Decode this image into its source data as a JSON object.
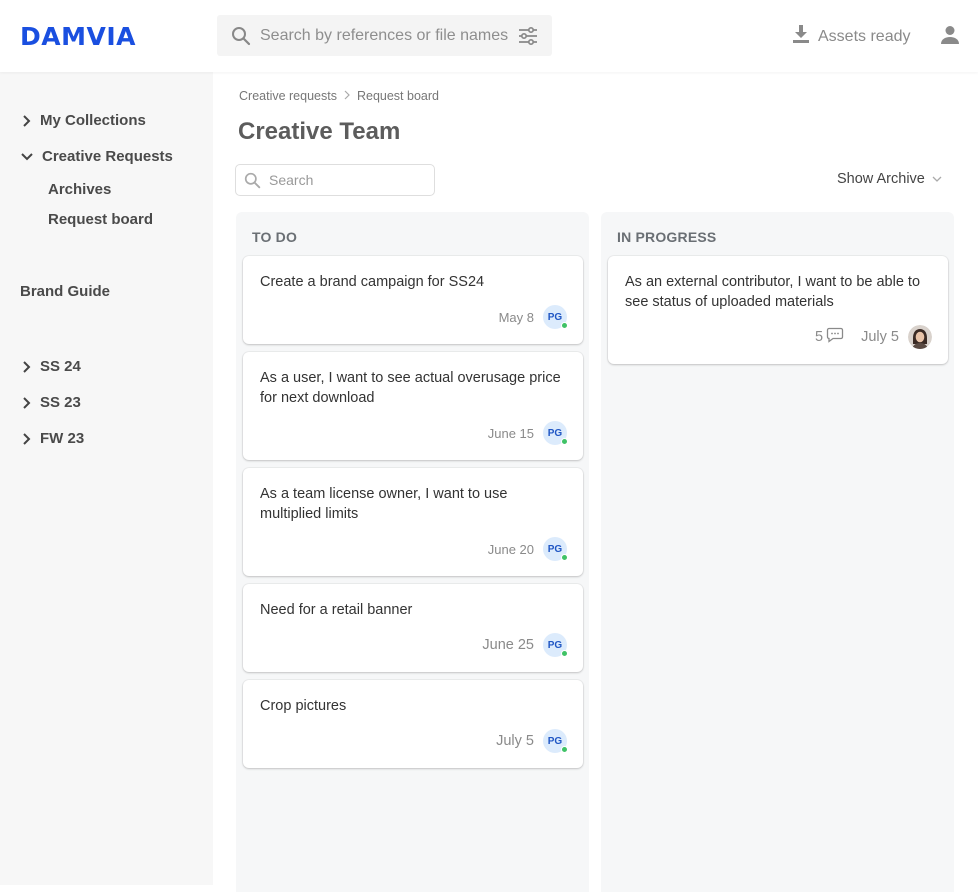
{
  "header": {
    "logo": "DAMVIA",
    "search_placeholder": "Search by references or file names",
    "assets_label": "Assets ready",
    "brand_color": "#1a4fe0"
  },
  "sidebar": {
    "items": [
      {
        "label": "My Collections",
        "chevron": "chevron-right"
      },
      {
        "label": "Creative Requests",
        "chevron": "chevron-down"
      },
      {
        "label": "Archives",
        "chevron": null
      },
      {
        "label": "Request board",
        "chevron": null
      },
      {
        "label": "Brand Guide",
        "chevron": null
      },
      {
        "label": "SS 24",
        "chevron": "chevron-right"
      },
      {
        "label": "SS 23",
        "chevron": "chevron-right"
      },
      {
        "label": "FW 23",
        "chevron": "chevron-right"
      }
    ]
  },
  "main": {
    "breadcrumb": [
      "Creative requests",
      "Request board"
    ],
    "title": "Creative Team",
    "search_placeholder": "Search",
    "show_archive_label": "Show Archive",
    "columns": [
      {
        "title": "TO DO",
        "cards": [
          {
            "title": "Create a brand campaign for SS24",
            "date": "May 8",
            "assignee": "PG"
          },
          {
            "title": "As a user, I want to see actual overusage price for next download",
            "date": "June 15",
            "assignee": "PG"
          },
          {
            "title": "As a team license owner, I want to use multiplied limits",
            "date": "June 20",
            "assignee": "PG"
          },
          {
            "title": "Need for a retail banner",
            "date": "June 25",
            "assignee": "PG"
          },
          {
            "title": "Crop pictures",
            "date": "July 5",
            "assignee": "PG"
          }
        ]
      },
      {
        "title": "IN PROGRESS",
        "cards": [
          {
            "title": "As an external contributor, I want to be able to see status of uploaded materials",
            "comments": "5",
            "date": "July 5",
            "assignee": "photo"
          }
        ]
      }
    ]
  }
}
